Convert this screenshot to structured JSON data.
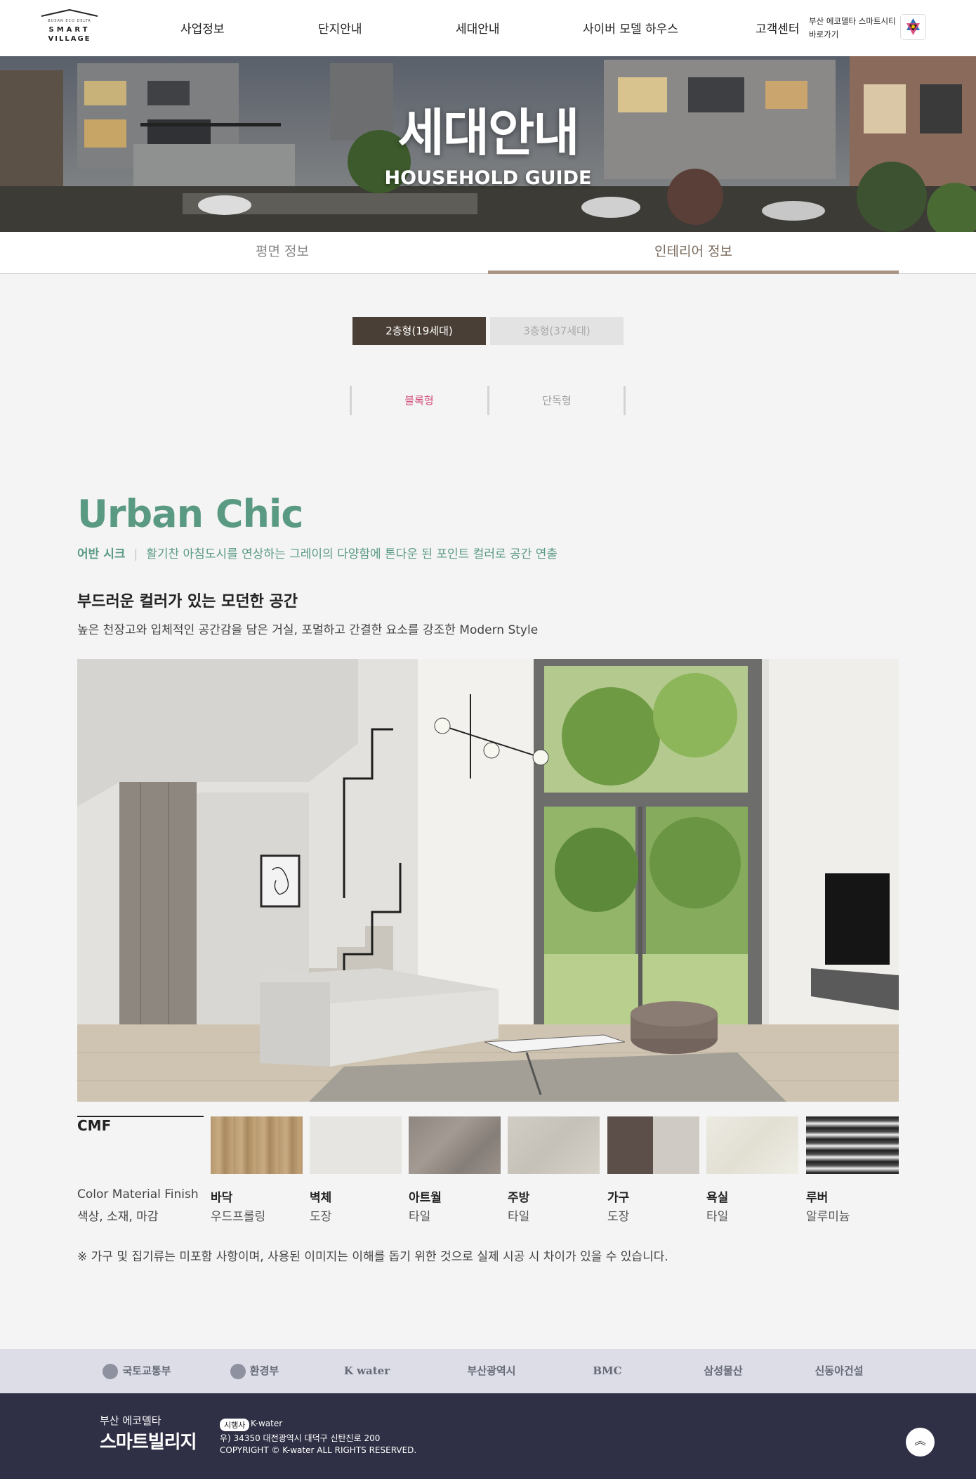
{
  "header": {
    "logo_small": "BUSAN ECO DELTA",
    "logo_line1": "SMART",
    "logo_line2": "VILLAGE",
    "nav": [
      "사업정보",
      "단지안내",
      "세대안내",
      "사이버 모델 하우스",
      "고객센터"
    ],
    "shortcut_line1": "부산 에코델타 스마트시티",
    "shortcut_line2": "바로가기"
  },
  "hero": {
    "title": "세대안내",
    "subtitle": "HOUSEHOLD GUIDE"
  },
  "subtabs": [
    "평면 정보",
    "인테리어 정보"
  ],
  "types": [
    "2층형(19세대)",
    "3층형(37세대)"
  ],
  "style_tabs": [
    "블록형",
    "단독형"
  ],
  "concept": {
    "title": "Urban Chic",
    "subtitle_ko": "어반 시크",
    "subtitle_desc": "활기찬 아침도시를 연상하는 그레이의 다양함에 톤다운 된 포인트 컬러로 공간 연출",
    "heading": "부드러운 컬러가 있는 모던한 공간",
    "description": "높은 천장고와 입체적인 공간감을 담은 거실, 포멀하고 간결한 요소를 강조한 Modern Style"
  },
  "cmf": {
    "label": "CMF",
    "desc_en": "Color Material Finish",
    "desc_ko": "색상, 소재, 마감",
    "items": [
      {
        "name": "바닥",
        "finish": "우드프롤링"
      },
      {
        "name": "벽체",
        "finish": "도장"
      },
      {
        "name": "아트월",
        "finish": "타일"
      },
      {
        "name": "주방",
        "finish": "타일"
      },
      {
        "name": "가구",
        "finish": "도장"
      },
      {
        "name": "욕실",
        "finish": "타일"
      },
      {
        "name": "루버",
        "finish": "알루미늄"
      }
    ]
  },
  "note": "※ 가구 및 집기류는 미포함 사항이며, 사용된 이미지는 이해를 돕기 위한 것으로 실제 시공 시 차이가 있을 수 있습니다.",
  "partners": [
    "국토교통부",
    "환경부",
    "K water",
    "부산광역시",
    "BMC",
    "삼성물산",
    "신동아건설"
  ],
  "footer": {
    "name1": "부산 에코델타",
    "name2": "스마트빌리지",
    "badge": "시행사",
    "org": "K-water",
    "address": "우) 34350 대전광역시 대덕구 신탄진로 200",
    "copyright": "COPYRIGHT © K-water ALL RIGHTS RESERVED."
  },
  "colors": {
    "accent_green": "#5a9a83",
    "active_dark": "#4a3f36",
    "tab_underline": "#a99583",
    "active_style_tab": "#d2497a",
    "footer_bg": "#2f2f45",
    "partners_bg": "#dcdde6"
  }
}
